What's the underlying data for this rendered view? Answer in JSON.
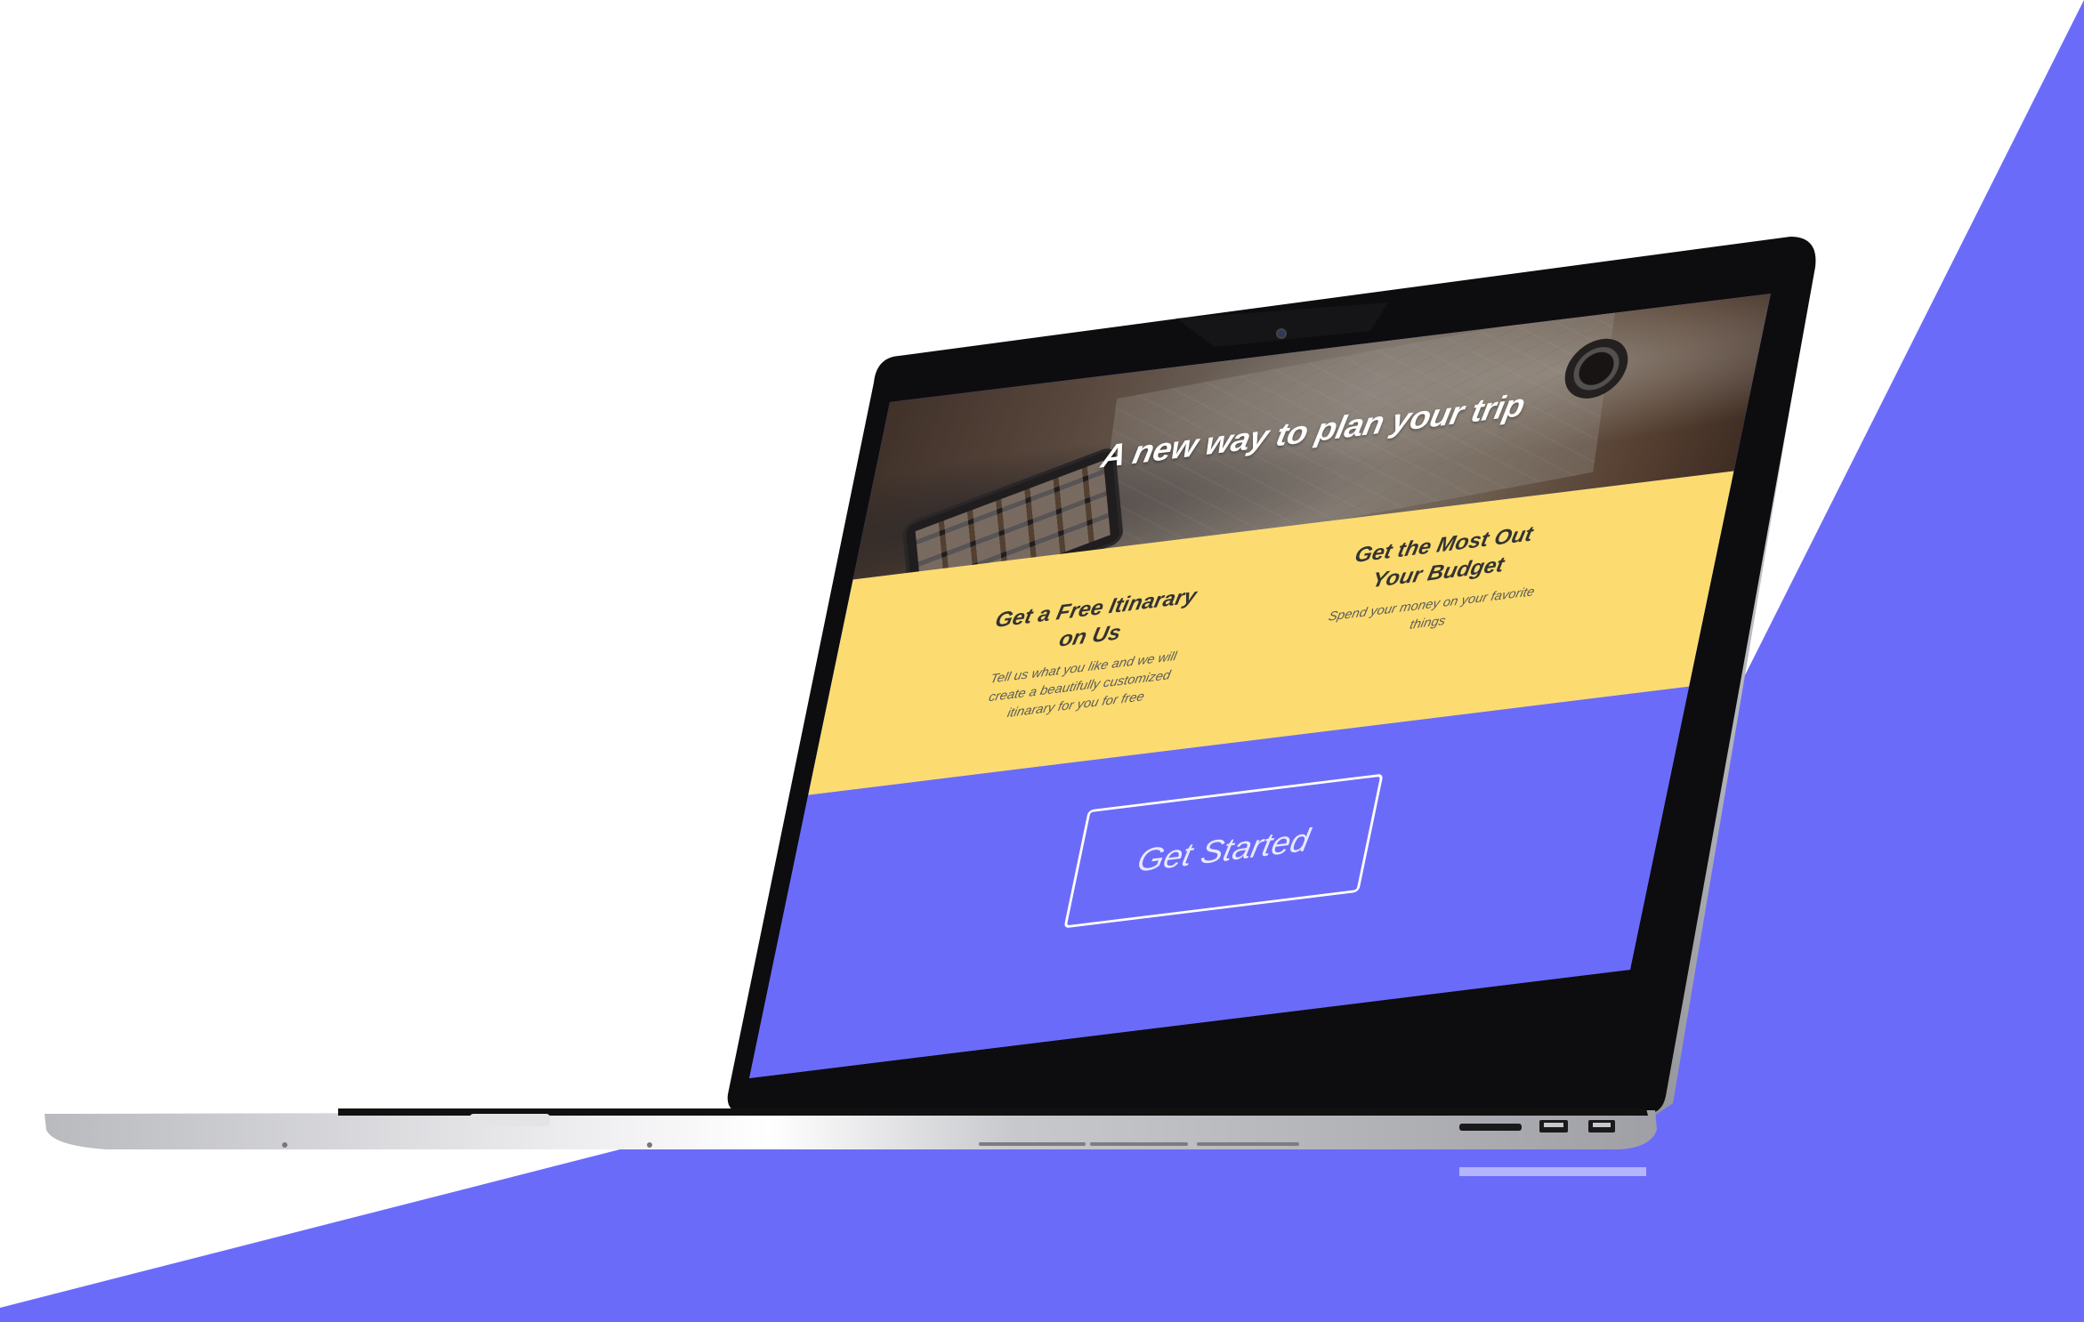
{
  "colors": {
    "accent_purple": "#6b6bfa",
    "feature_yellow": "#fcdc70",
    "text_dark": "#333333",
    "button_border": "#ffffff"
  },
  "hero": {
    "title": "A new way to plan your trip",
    "image": "travel-desk-photo"
  },
  "features": [
    {
      "title": "Get a Free Itinarary on Us",
      "description": "Tell us what you like and we will create a beautifully customized itinarary for you for free"
    },
    {
      "title": "Get the Most Out Your Budget",
      "description": "Spend your money on your favorite things"
    }
  ],
  "cta": {
    "label": "Get Started"
  }
}
